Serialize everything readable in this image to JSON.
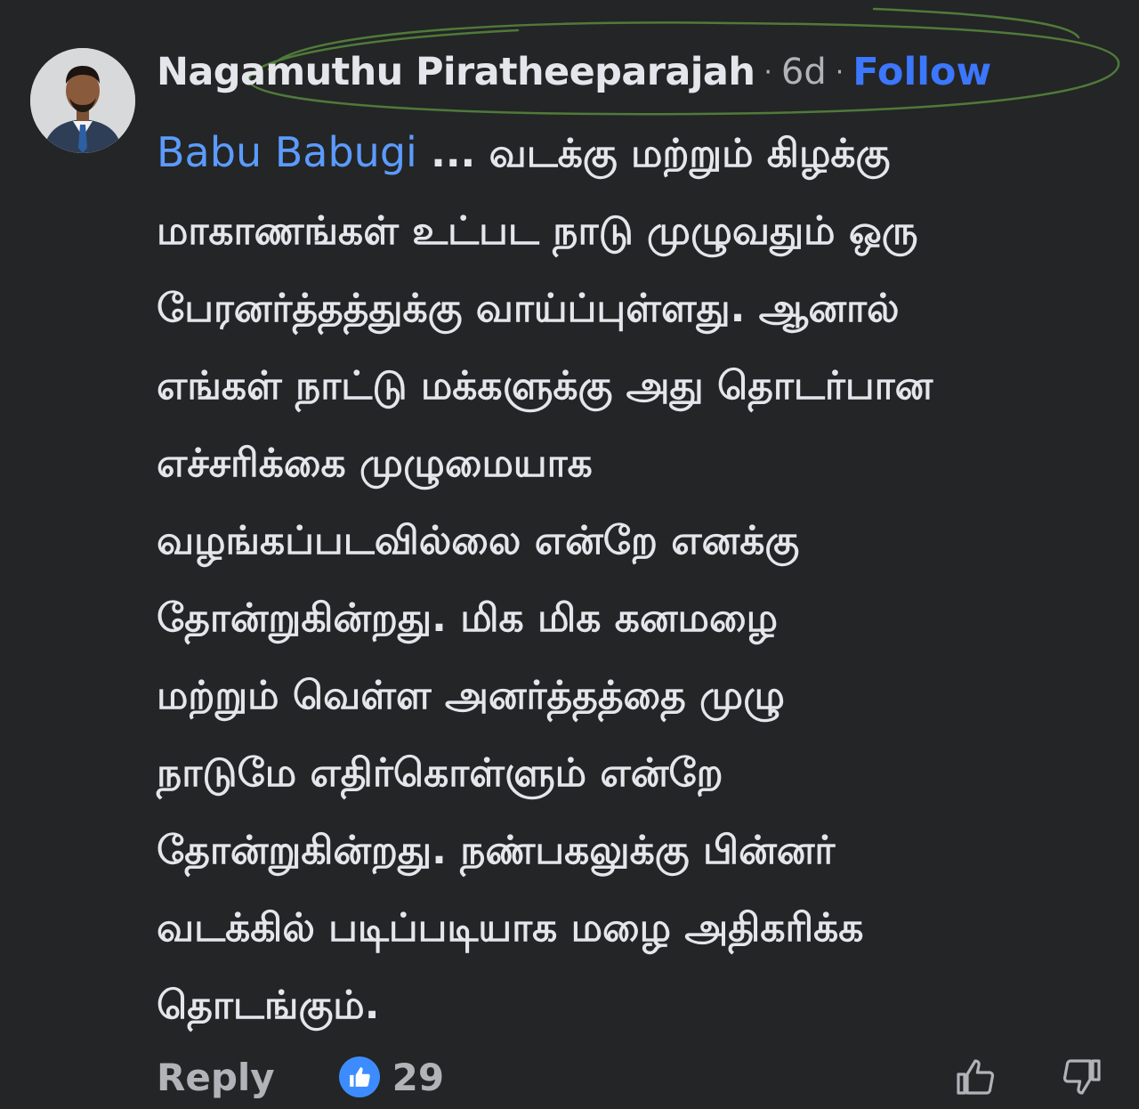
{
  "comment": {
    "author": "Nagamuthu Piratheeparajah",
    "separator": "·",
    "time": "6d",
    "follow_label": "Follow",
    "mention": "Babu Babugi",
    "text_lines": [
      " ... வடக்கு மற்றும் கிழக்கு",
      "மாகாணங்கள் உட்பட நாடு முழுவதும் ஒரு",
      "பேரனர்த்தத்துக்கு வாய்ப்புள்ளது. ஆனால்",
      "எங்கள் நாட்டு மக்களுக்கு அது தொடர்பான",
      "எச்சரிக்கை முழுமையாக",
      "வழங்கப்படவில்லை என்றே எனக்கு",
      "தோன்றுகின்றது. மிக மிக கனமழை",
      "மற்றும் வெள்ள அனர்த்தத்தை முழு",
      "நாடுமே எதிர்கொள்ளும் என்றே",
      "தோன்றுகின்றது. நண்பகலுக்கு பின்னர்",
      "வடக்கில் படிப்படியாக மழை அதிகரிக்க",
      "தொடங்கும்."
    ]
  },
  "actions": {
    "reply_label": "Reply",
    "reaction_count": "29",
    "reaction_icon": "thumbs-up-icon",
    "upvote_icon": "thumbs-up-outline-icon",
    "downvote_icon": "thumbs-down-outline-icon"
  },
  "colors": {
    "background": "#242526",
    "text": "#e4e6eb",
    "muted": "#b0b3b8",
    "follow": "#3c77ff",
    "mention": "#5b9bff",
    "like_badge": "#3d8cff",
    "highlight_ellipse": "#4f7a3a"
  }
}
